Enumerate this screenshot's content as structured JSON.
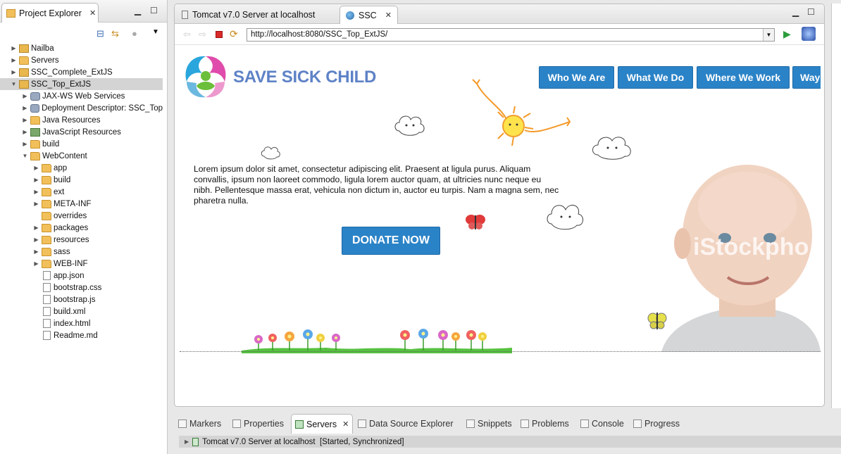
{
  "explorer": {
    "tab_label": "Project Explorer",
    "tree": [
      {
        "label": "Nailba",
        "depth": 0,
        "twisty": "▶",
        "icon": "project",
        "selected": false
      },
      {
        "label": "Servers",
        "depth": 0,
        "twisty": "▶",
        "icon": "folder",
        "selected": false
      },
      {
        "label": "SSC_Complete_ExtJS",
        "depth": 0,
        "twisty": "▶",
        "icon": "project",
        "selected": false
      },
      {
        "label": "SSC_Top_ExtJS",
        "depth": 0,
        "twisty": "▼",
        "icon": "project",
        "selected": true
      },
      {
        "label": "JAX-WS Web Services",
        "depth": 1,
        "twisty": "▶",
        "icon": "gear",
        "selected": false
      },
      {
        "label": "Deployment Descriptor: SSC_Top",
        "depth": 1,
        "twisty": "▶",
        "icon": "gear",
        "selected": false
      },
      {
        "label": "Java Resources",
        "depth": 1,
        "twisty": "▶",
        "icon": "folder",
        "selected": false
      },
      {
        "label": "JavaScript Resources",
        "depth": 1,
        "twisty": "▶",
        "icon": "jar",
        "selected": false
      },
      {
        "label": "build",
        "depth": 1,
        "twisty": "▶",
        "icon": "folder",
        "selected": false
      },
      {
        "label": "WebContent",
        "depth": 1,
        "twisty": "▼",
        "icon": "folder",
        "selected": false
      },
      {
        "label": "app",
        "depth": 2,
        "twisty": "▶",
        "icon": "folder",
        "selected": false
      },
      {
        "label": "build",
        "depth": 2,
        "twisty": "▶",
        "icon": "folder",
        "selected": false
      },
      {
        "label": "ext",
        "depth": 2,
        "twisty": "▶",
        "icon": "folder",
        "selected": false
      },
      {
        "label": "META-INF",
        "depth": 2,
        "twisty": "▶",
        "icon": "folder",
        "selected": false
      },
      {
        "label": "overrides",
        "depth": 2,
        "twisty": "",
        "icon": "folder",
        "selected": false
      },
      {
        "label": "packages",
        "depth": 2,
        "twisty": "▶",
        "icon": "folder",
        "selected": false
      },
      {
        "label": "resources",
        "depth": 2,
        "twisty": "▶",
        "icon": "folder",
        "selected": false
      },
      {
        "label": "sass",
        "depth": 2,
        "twisty": "▶",
        "icon": "folder",
        "selected": false
      },
      {
        "label": "WEB-INF",
        "depth": 2,
        "twisty": "▶",
        "icon": "folder",
        "selected": false
      },
      {
        "label": "app.json",
        "depth": 2,
        "twisty": "",
        "icon": "file",
        "selected": false
      },
      {
        "label": "bootstrap.css",
        "depth": 2,
        "twisty": "",
        "icon": "file",
        "selected": false
      },
      {
        "label": "bootstrap.js",
        "depth": 2,
        "twisty": "",
        "icon": "file",
        "selected": false
      },
      {
        "label": "build.xml",
        "depth": 2,
        "twisty": "",
        "icon": "file",
        "selected": false
      },
      {
        "label": "index.html",
        "depth": 2,
        "twisty": "",
        "icon": "file",
        "selected": false
      },
      {
        "label": "Readme.md",
        "depth": 2,
        "twisty": "",
        "icon": "file",
        "selected": false
      }
    ]
  },
  "editor": {
    "tabs": [
      {
        "label": "Tomcat v7.0 Server at localhost",
        "active": false
      },
      {
        "label": "SSC",
        "active": true
      }
    ],
    "url": "http://localhost:8080/SSC_Top_ExtJS/"
  },
  "site": {
    "title": "SAVE SICK CHILD",
    "nav": [
      "Who We Are",
      "What We Do",
      "Where We Work",
      "Way"
    ],
    "body_text": "Lorem ipsum dolor sit amet, consectetur adipiscing elit. Praesent at ligula purus. Aliquam convallis, ipsum non laoreet commodo, ligula lorem auctor quam, at ultricies nunc neque eu nibh. Pellentesque massa erat, vehicula non dictum in, auctor eu turpis. Nam a magna sem, nec pharetra nulla.",
    "donate_label": "DONATE NOW",
    "watermark": "iStockpho"
  },
  "bottom": {
    "tabs": [
      "Markers",
      "Properties",
      "Servers",
      "Data Source Explorer",
      "Snippets",
      "Problems",
      "Console",
      "Progress"
    ],
    "active_tab": "Servers",
    "server_row": "Tomcat v7.0 Server at localhost  [Started, Synchronized]"
  }
}
